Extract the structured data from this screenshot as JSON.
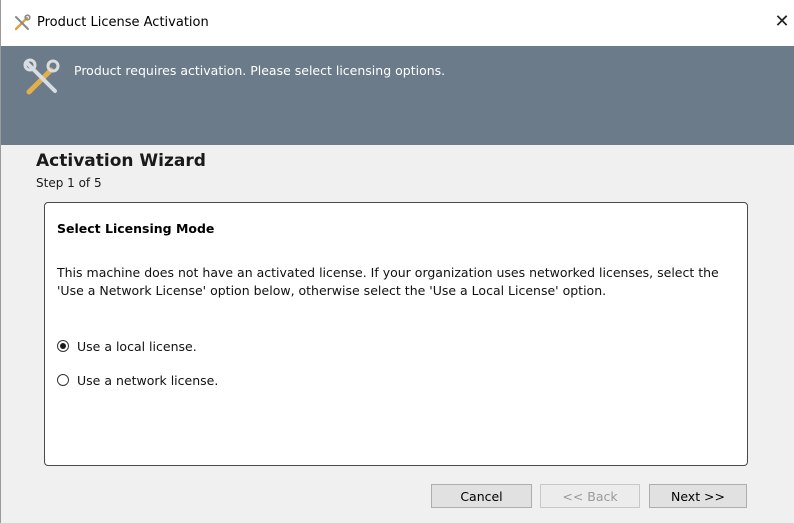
{
  "window": {
    "title": "Product License Activation",
    "close_glyph": "✕"
  },
  "banner": {
    "message": "Product requires activation. Please select licensing options.",
    "icon": "tools-icon",
    "background": "#6b7b89"
  },
  "wizard": {
    "title": "Activation Wizard",
    "step": "Step 1 of 5"
  },
  "panel": {
    "title": "Select Licensing Mode",
    "description": "This machine does not have an activated license. If your organization uses networked licenses, select the 'Use a Network License' option below, otherwise select the 'Use a Local License' option.",
    "options": [
      {
        "label": "Use a local license.",
        "checked": true
      },
      {
        "label": "Use a network license.",
        "checked": false
      }
    ]
  },
  "buttons": {
    "cancel": "Cancel",
    "back": "<< Back",
    "next": "Next >>"
  }
}
